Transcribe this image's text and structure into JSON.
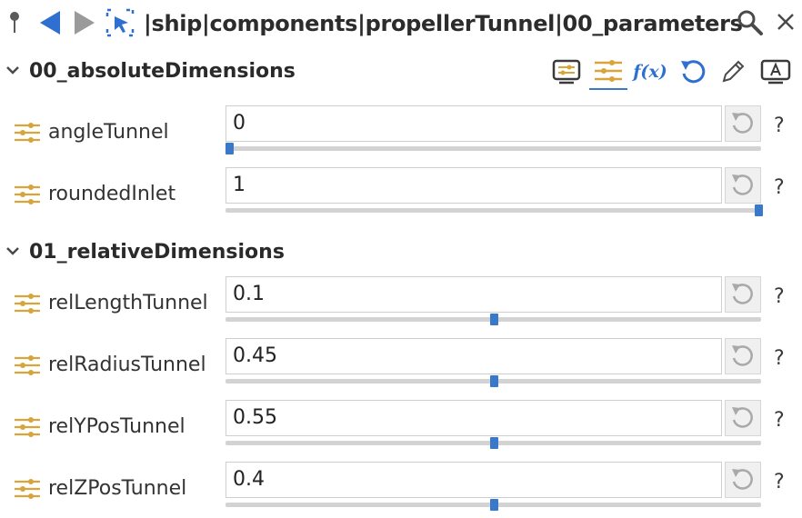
{
  "toolbar": {
    "path": "|ship|components|propellerTunnel|00_parameters",
    "icons": [
      "pin-icon",
      "back-arrow-icon",
      "forward-arrow-icon",
      "select-cursor-icon",
      "search-icon",
      "close-icon"
    ]
  },
  "sections": [
    {
      "title": "00_absoluteDimensions",
      "tools": {
        "function_label": "f(x)",
        "icons": [
          "display-panel-icon",
          "sliders-icon",
          "function-icon",
          "reset-all-icon",
          "edit-pencil-icon",
          "text-label-icon"
        ]
      },
      "params": [
        {
          "label": "angleTunnel",
          "value": "0",
          "slider_fraction": 0.0
        },
        {
          "label": "roundedInlet",
          "value": "1",
          "slider_fraction": 1.0
        }
      ]
    },
    {
      "title": "01_relativeDimensions",
      "params": [
        {
          "label": "relLengthTunnel",
          "value": "0.1",
          "slider_fraction": 0.5
        },
        {
          "label": "relRadiusTunnel",
          "value": "0.45",
          "slider_fraction": 0.5
        },
        {
          "label": "relYPosTunnel",
          "value": "0.55",
          "slider_fraction": 0.5
        },
        {
          "label": "relZPosTunnel",
          "value": "0.4",
          "slider_fraction": 0.5
        }
      ]
    }
  ],
  "help_text": "?",
  "colors": {
    "accent_blue": "#3a78c9",
    "slider_icon_gold": "#d9a43a",
    "arrow_grey": "#9a9a9a"
  }
}
